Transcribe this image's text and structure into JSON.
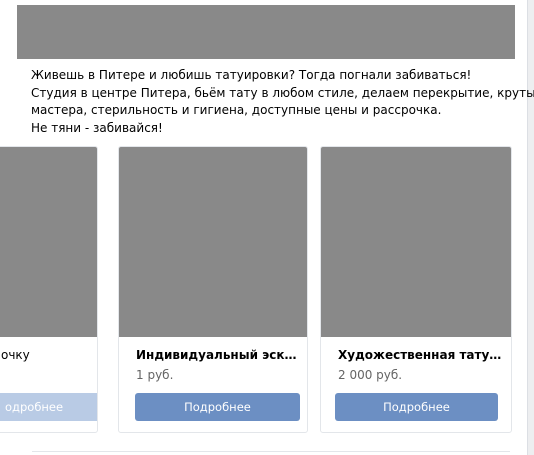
{
  "post": {
    "text_lines": [
      "Живешь в Питере и любишь татуировки? Тогда погнали забиваться!",
      "Студия в центре Питера, бьём тату в любом стиле, делаем перекрытие, крутые",
      "мастера, стерильность и гигиена, доступные цены и рассрочка.",
      "Не тяни - забивайся!"
    ]
  },
  "carousel": {
    "cards": [
      {
        "title": "очку",
        "price": "",
        "button_label": "одробнее"
      },
      {
        "title": "Индивидуальный эскиз",
        "price": "1 руб.",
        "button_label": "Подробнее"
      },
      {
        "title": "Художественная татуиров...",
        "price": "2 000 руб.",
        "button_label": "Подробнее"
      }
    ]
  }
}
